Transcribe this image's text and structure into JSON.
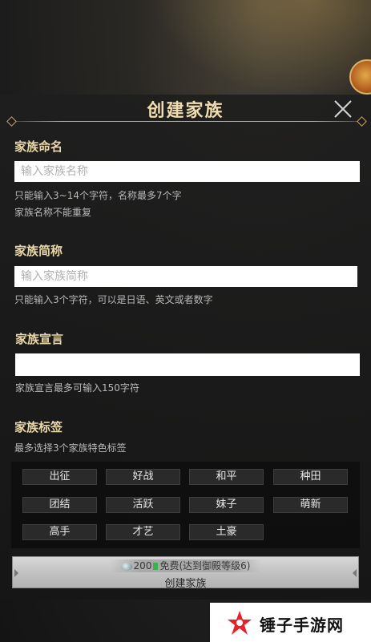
{
  "dialog": {
    "title": "创建家族"
  },
  "clan_name": {
    "label": "家族命名",
    "placeholder": "输入家族名称",
    "hint_line1": "只能输入3~14个字符，名称最多7个字",
    "hint_line2": "家族名称不能重复"
  },
  "clan_abbr": {
    "label": "家族简称",
    "placeholder": "输入家族简称",
    "hint": "只能输入3个字符，可以是日语、英文或者数字"
  },
  "clan_declaration": {
    "label": "家族宣言",
    "value": "",
    "hint": "家族宣言最多可输入150字符"
  },
  "clan_tags": {
    "label": "家族标签",
    "hint": "最多选择3个家族特色标签",
    "tags": [
      "出征",
      "好战",
      "和平",
      "种田",
      "团结",
      "活跃",
      "妹子",
      "萌新",
      "高手",
      "才艺",
      "土豪"
    ]
  },
  "create_button": {
    "cost_amount": "200",
    "cost_note": "免费(达到御殿等级6)",
    "label": "创建家族"
  },
  "watermark": {
    "text": "锤子手游网"
  },
  "colors": {
    "gold": "#e9d6a8",
    "free_green": "#3bb24a",
    "watermark_red": "#e8202a"
  }
}
